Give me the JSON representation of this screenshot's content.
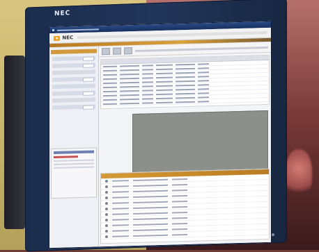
{
  "monitor": {
    "brand": "NEC"
  },
  "app": {
    "logo_text": "NEC"
  },
  "screen": {
    "top_rows": 10,
    "bottom_rows": 11
  }
}
